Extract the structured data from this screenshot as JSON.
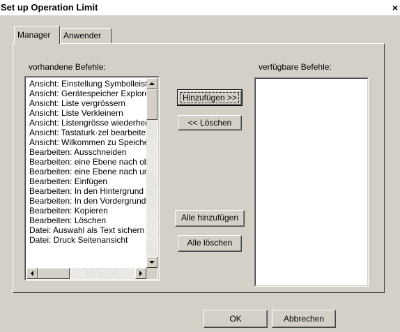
{
  "window": {
    "title": "Set up Operation Limit",
    "close_glyph": "×"
  },
  "tabs": [
    {
      "label": "Manager",
      "active": true
    },
    {
      "label": "Anwender",
      "active": false
    }
  ],
  "left_list": {
    "label": "vorhandene Befehle:",
    "items": [
      "Ansicht: Einstellung Symbolleiste",
      "Ansicht: Gerätespeicher Explorer",
      "Ansicht: Liste vergrössern",
      "Ansicht: Liste Verkleinern",
      "Ansicht: Listengrösse wiederherstellen",
      "Ansicht: Tastaturk·zel bearbeiten",
      "Ansicht: Wilkommen zu Speicher",
      "Bearbeiten: Ausschneiden",
      "Bearbeiten: eine Ebene nach oben",
      "Bearbeiten: eine Ebene nach unten",
      "Bearbeiten: Einfügen",
      "Bearbeiten: In den Hintergrund",
      "Bearbeiten: In den Vordergrund",
      "Bearbeiten: Kopieren",
      "Bearbeiten: Löschen",
      "Datei: Auswahl als Text sichern",
      "Datei: Druck Seitenansicht"
    ]
  },
  "right_list": {
    "label": "verfügbare Befehle:",
    "items": []
  },
  "buttons": {
    "add": "Hinzufügen >>",
    "remove": "<< Löschen",
    "add_all": "Alle hinzufügen",
    "remove_all": "Alle löschen",
    "ok": "OK",
    "cancel": "Abbrechen"
  },
  "icons": {
    "scroll_up": "up-arrow-icon",
    "scroll_down": "down-arrow-icon",
    "scroll_left": "left-arrow-icon",
    "scroll_right": "right-arrow-icon"
  }
}
